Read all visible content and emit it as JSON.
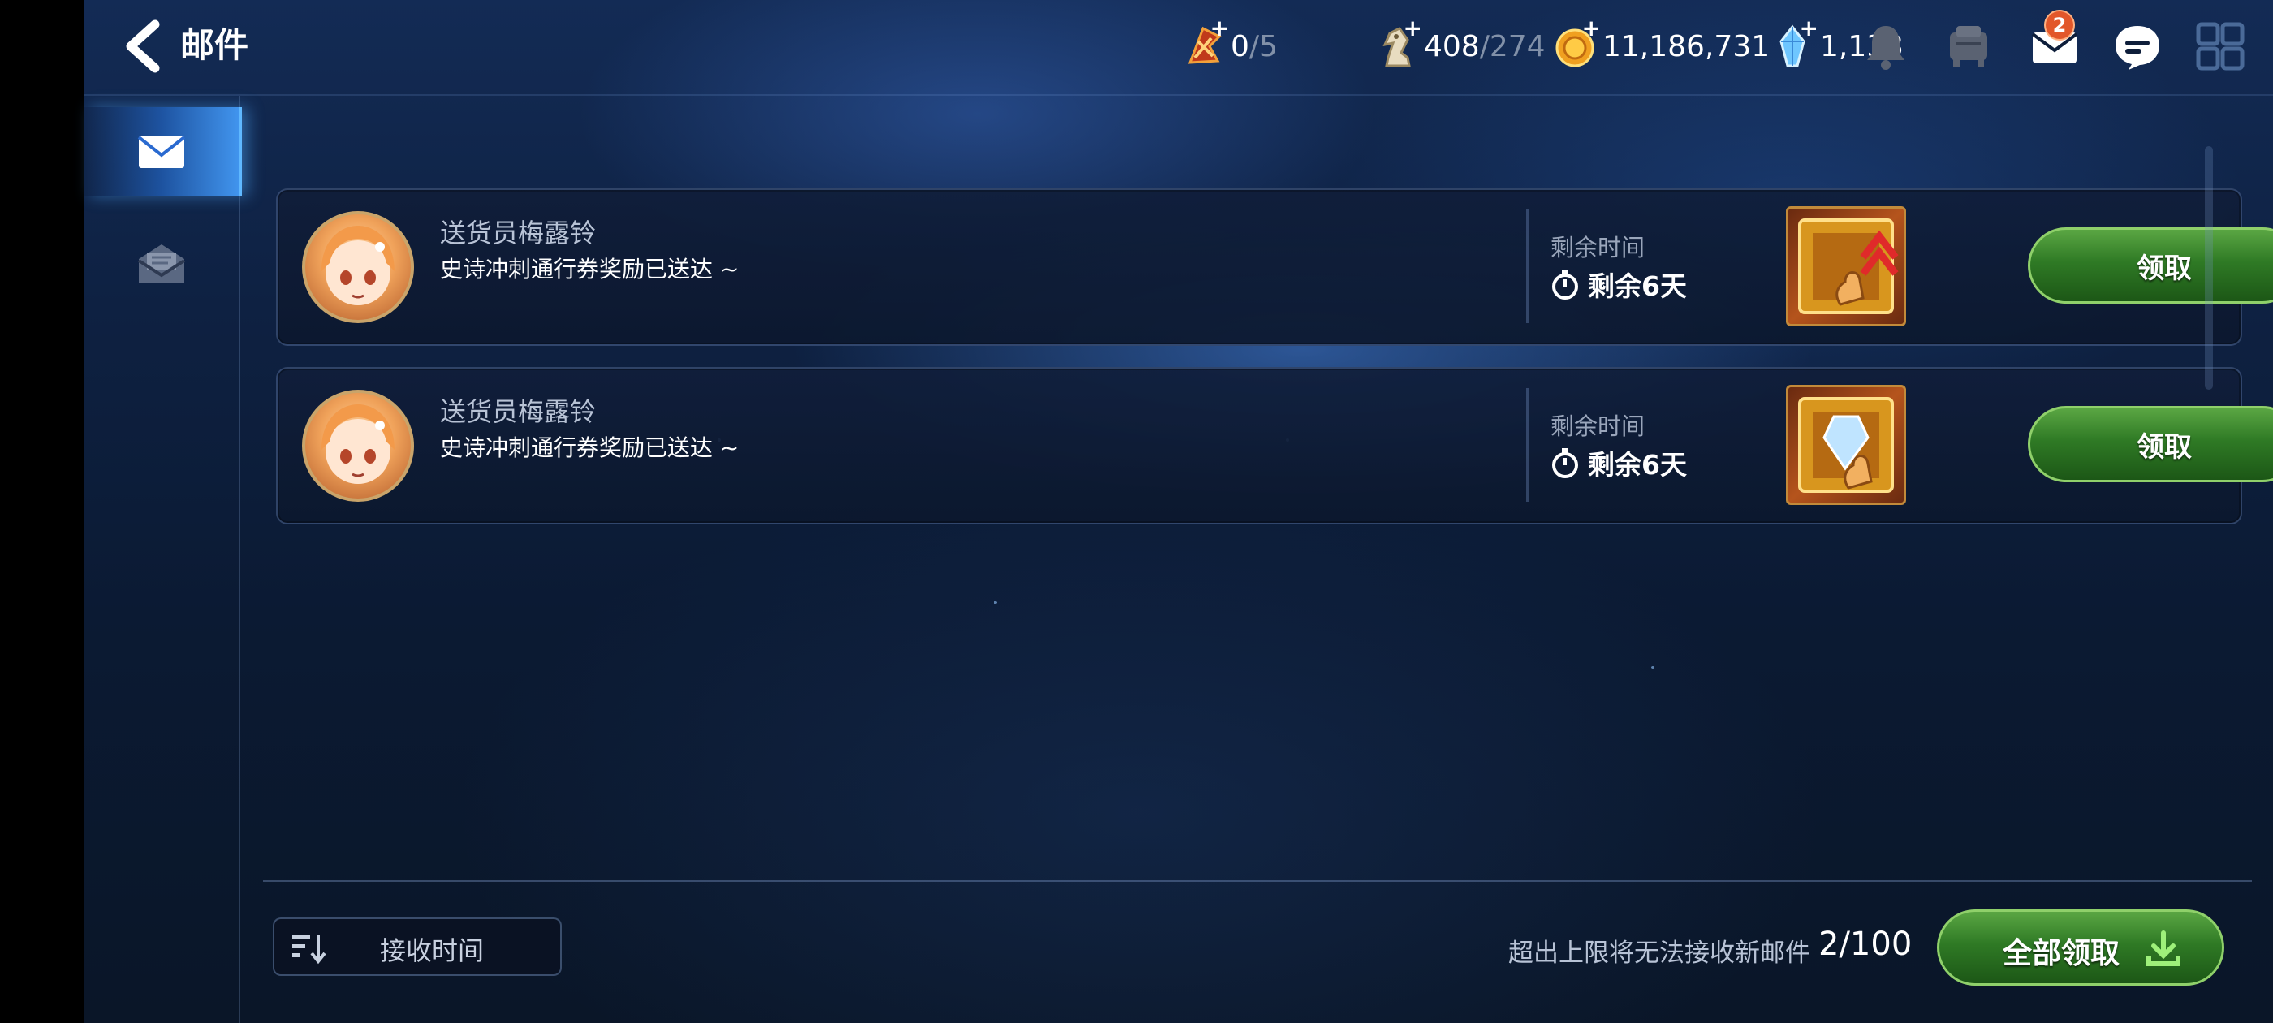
{
  "header": {
    "title": "邮件",
    "back_icon": "chevron-left-icon"
  },
  "currencies": [
    {
      "name": "stamina-ticket",
      "icon": "flag-icon",
      "value": "0",
      "max": "/5"
    },
    {
      "name": "knight-token",
      "icon": "chess-knight-icon",
      "value": "408",
      "max": "/274"
    },
    {
      "name": "gold",
      "icon": "gold-coin-icon",
      "value": "11,186,731",
      "max": ""
    },
    {
      "name": "gem",
      "icon": "crystal-icon",
      "value": "1,133",
      "max": ""
    }
  ],
  "top_icons": {
    "bell": "bell-icon",
    "chair": "lobby-icon",
    "mail": "mail-icon",
    "mail_badge": "2",
    "chat": "chat-icon",
    "menu": "grid-menu-icon"
  },
  "sidebar": {
    "tabs": [
      {
        "name": "inbox",
        "icon": "envelope-icon",
        "active": true
      },
      {
        "name": "read",
        "icon": "open-envelope-icon",
        "active": false
      }
    ]
  },
  "mails": [
    {
      "sender": "送货员梅露铃",
      "message": "史诗冲刺通行券奖励已送达 ~",
      "remain_label": "剩余时间",
      "remain_value": "剩余6天",
      "reward_icon": "pass-upgrade-icon",
      "claim_label": "领取"
    },
    {
      "sender": "送货员梅露铃",
      "message": "史诗冲刺通行券奖励已送达 ~",
      "remain_label": "剩余时间",
      "remain_value": "剩余6天",
      "reward_icon": "pass-crystal-icon",
      "claim_label": "领取"
    }
  ],
  "footer": {
    "sort_label": "接收时间",
    "limit_text": "超出上限将无法接收新邮件",
    "mail_count": "2/100",
    "claim_all_label": "全部领取"
  },
  "colors": {
    "claim_green": "#2f7a25",
    "badge_orange": "#e2572a",
    "active_tab_blue": "#5fb8ff"
  }
}
